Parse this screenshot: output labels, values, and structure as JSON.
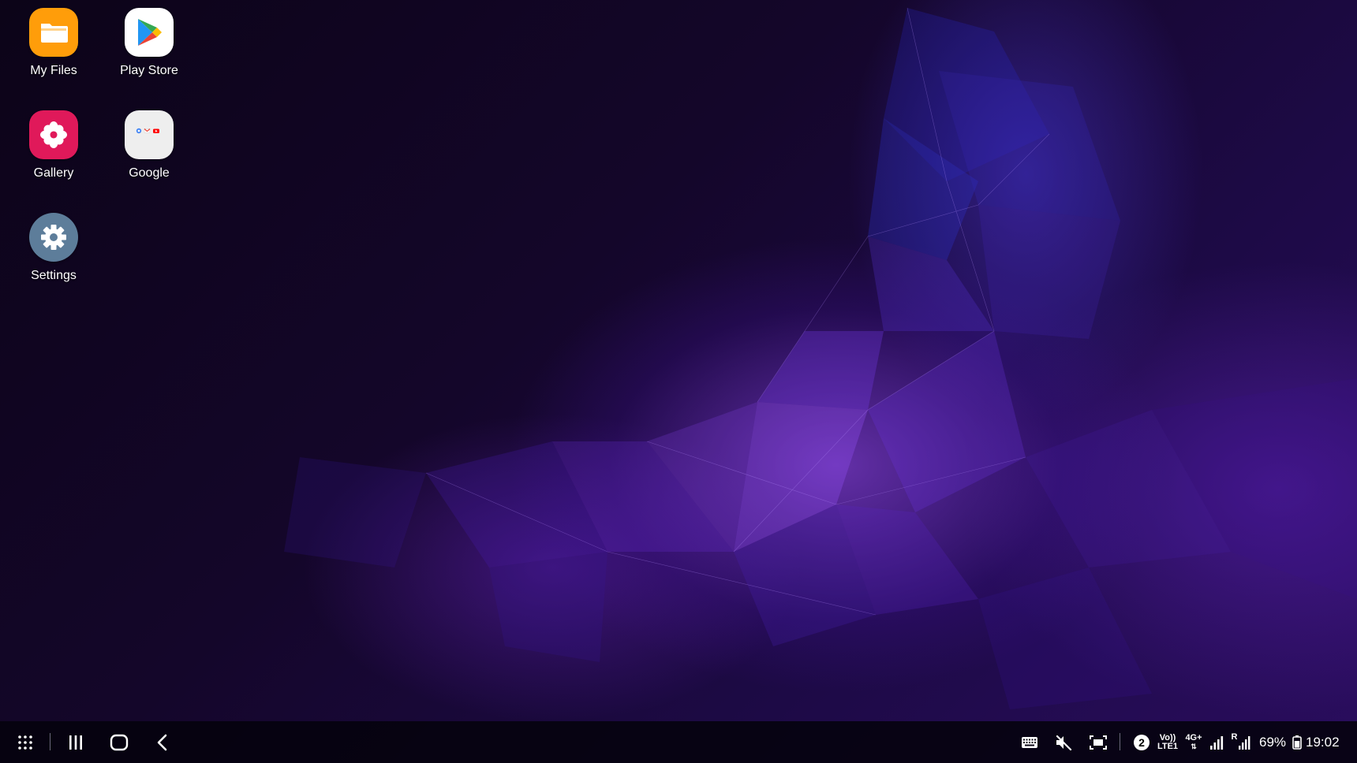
{
  "desktop": {
    "apps": [
      {
        "label": "My Files",
        "icon": "folder-icon",
        "color": "#ff9d0a"
      },
      {
        "label": "Play Store",
        "icon": "play-store-icon",
        "color": "#ffffff"
      },
      {
        "label": "Gallery",
        "icon": "flower-icon",
        "color": "#e0195a"
      },
      {
        "label": "Google",
        "icon": "google-folder-icon",
        "color": "#eeeeee"
      },
      {
        "label": "Settings",
        "icon": "gear-icon",
        "color": "#5d7d9a"
      }
    ]
  },
  "taskbar": {
    "left_icons": [
      "apps-grid-icon",
      "recents-icon",
      "home-icon",
      "back-icon"
    ],
    "right_icons": [
      "keyboard-icon",
      "mute-icon",
      "screen-capture-icon"
    ],
    "notification_count": "2",
    "volte_top": "Vo))",
    "volte_bottom": "LTE1",
    "network_type": "4G+",
    "roaming": "R",
    "battery": "69%",
    "time": "19:02"
  }
}
